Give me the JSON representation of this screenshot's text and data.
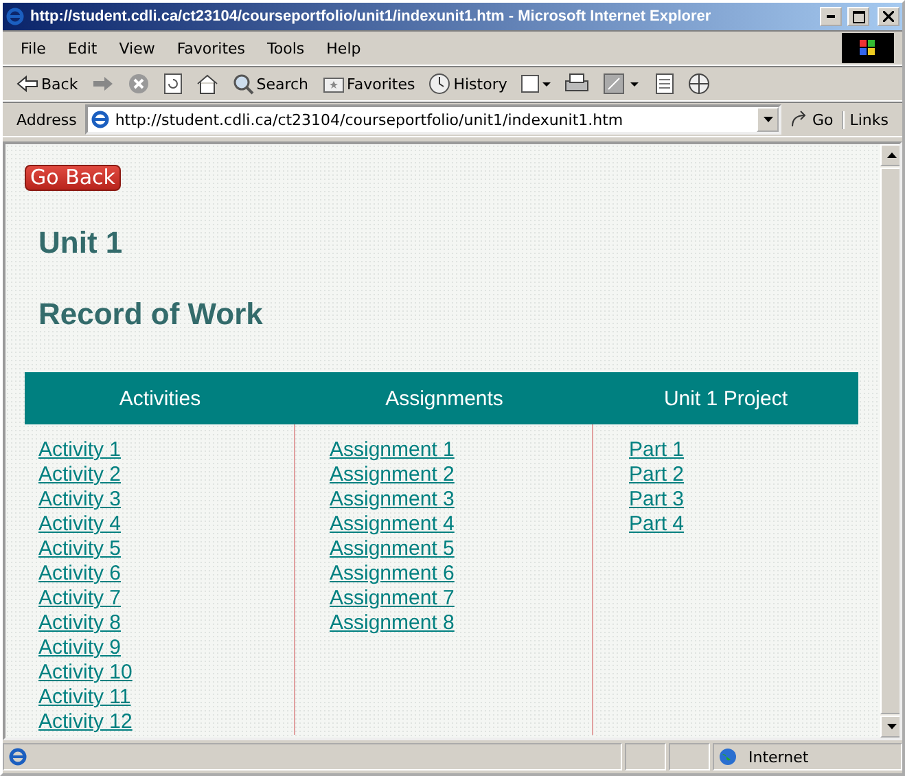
{
  "window": {
    "title": "http://student.cdli.ca/ct23104/courseportfolio/unit1/indexunit1.htm - Microsoft Internet Explorer"
  },
  "menu": [
    "File",
    "Edit",
    "View",
    "Favorites",
    "Tools",
    "Help"
  ],
  "toolbar": [
    {
      "kind": "back",
      "label": "Back"
    },
    {
      "kind": "forward"
    },
    {
      "kind": "stop"
    },
    {
      "kind": "refresh"
    },
    {
      "kind": "home"
    },
    {
      "kind": "search",
      "label": "Search"
    },
    {
      "kind": "favorites",
      "label": "Favorites"
    },
    {
      "kind": "history",
      "label": "History"
    },
    {
      "kind": "mail"
    },
    {
      "kind": "print"
    },
    {
      "kind": "edit"
    },
    {
      "kind": "discuss"
    },
    {
      "kind": "messenger"
    }
  ],
  "address": {
    "label": "Address",
    "value": "http://student.cdli.ca/ct23104/courseportfolio/unit1/indexunit1.htm",
    "go": "Go",
    "links": "Links"
  },
  "page": {
    "back_button": "Go Back",
    "headings": [
      "Unit 1",
      "Record of Work"
    ],
    "columns": [
      {
        "heading": "Activities",
        "links": [
          "Activity 1",
          "Activity 2",
          "Activity 3",
          "Activity 4",
          "Activity 5",
          "Activity 6",
          "Activity 7",
          "Activity 8",
          "Activity 9",
          "Activity 10",
          "Activity 11",
          "Activity 12"
        ]
      },
      {
        "heading": "Assignments",
        "links": [
          "Assignment 1",
          "Assignment 2",
          "Assignment 3",
          "Assignment 4",
          "Assignment 5",
          "Assignment 6",
          "Assignment 7",
          "Assignment 8"
        ]
      },
      {
        "heading": "Unit 1 Project",
        "links": [
          "Part 1",
          "Part 2",
          "Part 3",
          "Part 4"
        ]
      }
    ]
  },
  "status_bar": {
    "zone": "Internet"
  }
}
